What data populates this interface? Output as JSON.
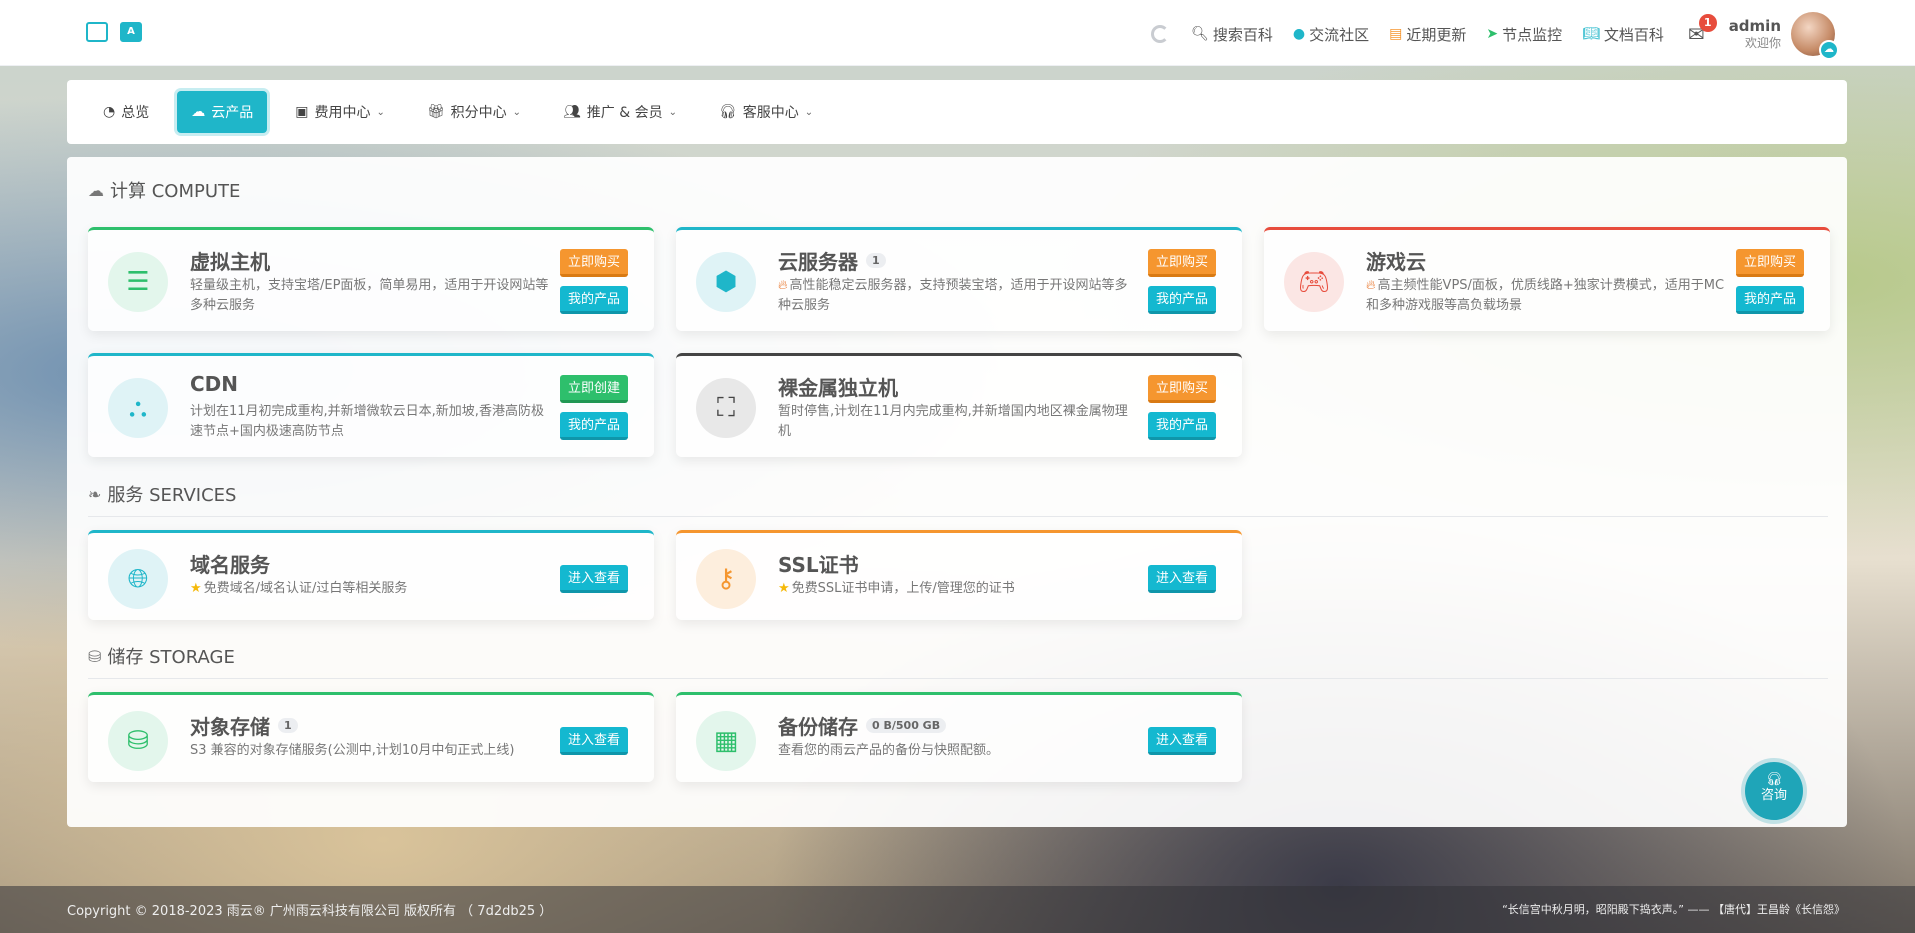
{
  "header": {
    "nav": [
      {
        "icon": "search-icon",
        "label": "搜索百科"
      },
      {
        "icon": "community-icon",
        "label": "交流社区"
      },
      {
        "icon": "updates-icon",
        "label": "近期更新"
      },
      {
        "icon": "monitor-icon",
        "label": "节点监控"
      },
      {
        "icon": "docs-icon",
        "label": "文档百科"
      }
    ],
    "mail_badge": "1",
    "user": {
      "name": "admin",
      "welcome": "欢迎你"
    }
  },
  "menu": [
    {
      "label": "总览",
      "icon": "dashboard-icon"
    },
    {
      "label": "云产品",
      "icon": "cloud-products-icon",
      "active": true
    },
    {
      "label": "费用中心",
      "icon": "billing-icon"
    },
    {
      "label": "积分中心",
      "icon": "gift-icon"
    },
    {
      "label": "推广 & 会员",
      "icon": "users-icon"
    },
    {
      "label": "客服中心",
      "icon": "headset-icon"
    }
  ],
  "sections": {
    "compute": "计算 COMPUTE",
    "services": "服务 SERVICES",
    "storage": "储存 STORAGE"
  },
  "cards": {
    "vhost": {
      "title": "虚拟主机",
      "desc": "轻量级主机，支持宝塔/EP面板，简单易用，适用于开设网站等多种云服务",
      "btn1": "立即购买",
      "btn2": "我的产品"
    },
    "cvm": {
      "title": "云服务器",
      "count": "1",
      "desc": "高性能稳定云服务器，支持预装宝塔，适用于开设网站等多种云服务",
      "btn1": "立即购买",
      "btn2": "我的产品"
    },
    "game": {
      "title": "游戏云",
      "desc": "高主频性能VPS/面板，优质线路+独家计费模式，适用于MC和多种游戏服等高负载场景",
      "btn1": "立即购买",
      "btn2": "我的产品"
    },
    "cdn": {
      "title": "CDN",
      "desc": "计划在11月初完成重构,并新增微软云日本,新加坡,香港高防极速节点+国内极速高防节点",
      "btn1": "立即创建",
      "btn2": "我的产品"
    },
    "bare": {
      "title": "裸金属独立机",
      "desc": "暂时停售,计划在11月内完成重构,并新增国内地区裸金属物理机",
      "btn1": "立即购买",
      "btn2": "我的产品"
    },
    "domain": {
      "title": "域名服务",
      "desc": "免费域名/域名认证/过白等相关服务",
      "btn": "进入查看"
    },
    "ssl": {
      "title": "SSL证书",
      "desc": "免费SSL证书申请，上传/管理您的证书",
      "btn": "进入查看"
    },
    "oss": {
      "title": "对象存储",
      "count": "1",
      "desc": "S3 兼容的对象存储服务(公测中,计划10月中旬正式上线)",
      "btn": "进入查看"
    },
    "backup": {
      "title": "备份储存",
      "count": "0 B/500 GB",
      "desc": "查看您的雨云产品的备份与快照配额。",
      "btn": "进入查看"
    }
  },
  "consult": "咨询",
  "footer": {
    "copyright": "Copyright © 2018-2023 雨云® 广州雨云科技有限公司 版权所有 （ 7d2db25 ）",
    "quote": "“长信宫中秋月明，昭阳殿下捣衣声。” —— 【唐代】王昌龄《长信怨》"
  },
  "colors": {
    "accent": "#1fb6c9",
    "green": "#2ebf6c",
    "orange": "#f5962f",
    "red": "#e74c3c"
  }
}
